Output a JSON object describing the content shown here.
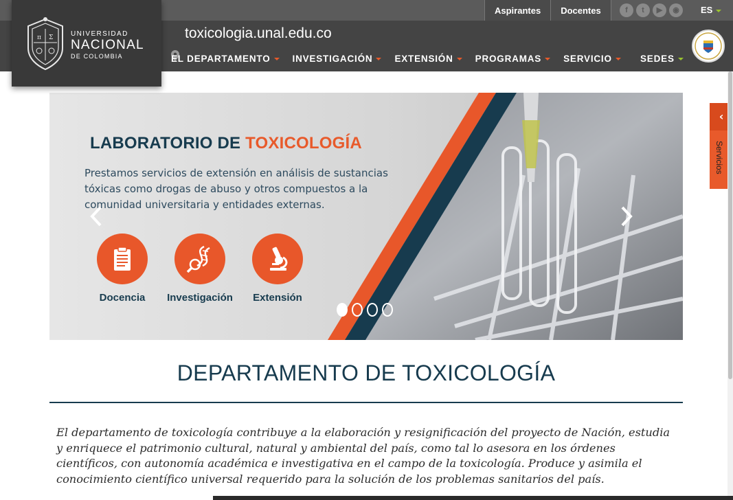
{
  "header": {
    "logo": {
      "line1": "UNIVERSIDAD",
      "line2": "NACIONAL",
      "line3": "DE COLOMBIA"
    },
    "url": "toxicologia.unal.edu.co",
    "top_tabs": [
      "Aspirantes",
      "Docentes"
    ],
    "social_icons": [
      "facebook-icon",
      "twitter-icon",
      "youtube-icon",
      "rss-icon"
    ],
    "language": "ES",
    "nav": [
      "EL DEPARTAMENTO",
      "INVESTIGACIÓN",
      "EXTENSIÓN",
      "PROGRAMAS",
      "SERVICIO"
    ],
    "sedes": "SEDES",
    "accent_color": "#e85a2b",
    "sedes_accent": "#9ac32f"
  },
  "carousel": {
    "title_part1": "LABORATORIO DE ",
    "title_part2": "TOXICOLOGÍA",
    "description": "Prestamos servicios de extensión en análisis de sustancias tóxicas como drogas de abuso y otros compuestos a la comunidad universitaria y entidades externas.",
    "features": [
      {
        "label": "Docencia",
        "icon": "clipboard-icon"
      },
      {
        "label": "Investigación",
        "icon": "dna-icon"
      },
      {
        "label": "Extensión",
        "icon": "microscope-icon"
      }
    ],
    "active_slide": 1,
    "slide_count": 4
  },
  "side_tab": {
    "label": "Servicios"
  },
  "main": {
    "title": "DEPARTAMENTO DE TOXICOLOGÍA",
    "intro": "El departamento de toxicología contribuye a la elaboración y resignificación del proyecto de Nación, estudia y enriquece el patrimonio cultural, natural y ambiental del país, como tal lo asesora en los órdenes científicos, con autonomía académica e investigativa en el campo de la toxicología. Produce y asimila el conocimiento científico universal requerido para la solución de los problemas sanitarios del país.",
    "title_color": "#173b4e"
  }
}
